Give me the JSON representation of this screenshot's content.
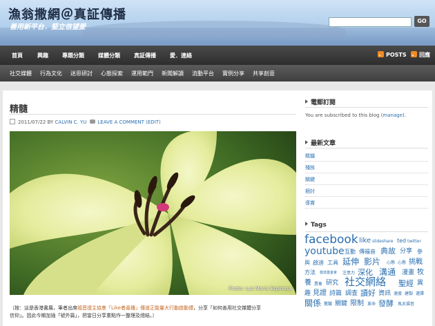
{
  "site": {
    "title": "漁翁撒網＠真証傳播",
    "tagline": "善用新平台．堅立信望愛",
    "search_button": "GO"
  },
  "nav_primary": {
    "items": [
      "首頁",
      "興趣",
      "專題分類",
      "媒體分類",
      "真証傳播",
      "愛．連絡"
    ],
    "feeds": [
      "POSTS",
      "回應"
    ]
  },
  "nav_secondary": {
    "items": [
      "社交媒體",
      "行為文化",
      "迷思研討",
      "心態探索",
      "運用範門",
      "新聞解讀",
      "流動平台",
      "實例分享",
      "共享創意"
    ]
  },
  "post": {
    "title": "精髓",
    "date": "2011/07/22",
    "by": "BY",
    "author": "CALVIN C. YU",
    "comment": "LEAVE A COMMENT",
    "edit": "(EDIT)",
    "photo_credit": "Photo: Luz Maria Espinosa",
    "caption_line1_a": "（按：這是香港書展，筆者出席",
    "caption_line1_link": "福音證主協會「Like者尋播」傳道正能量大行動啟動禮",
    "caption_line1_b": "，分享「如何善用社交媒體分享",
    "caption_line2": "信仰」。因此今期加插「號外篇」，把當日分享重點作一整理及總結。）"
  },
  "sidebar": {
    "email_title": "電郵訂閱",
    "subscribed_text_a": "You are subscribed to this blog (",
    "subscribed_link": "manage",
    "subscribed_text_b": ").",
    "recent_title": "最新文章",
    "recent_items": [
      "精髓",
      "殘核",
      "關鍵",
      "捆討",
      "導賞"
    ],
    "tags_title": "Tags",
    "tags": [
      "facebook",
      "like",
      "slideshare",
      "ted",
      "twitter",
      "youtube",
      "互動",
      "傳福音",
      "典故",
      "分享",
      "參",
      "與",
      "啟迪",
      "工具",
      "延伸",
      "影片",
      "心態",
      "心態",
      "挑戰",
      "方法",
      "施達基金會",
      "注意力",
      "深化",
      "溝通",
      "漫畫",
      "牧",
      "養",
      "異象",
      "研究",
      "社交網絡",
      "聖經",
      "異",
      "趣",
      "見證",
      "詩篇",
      "調查",
      "讀好",
      "資訊",
      "速度",
      "建製",
      "選擇",
      "關係",
      "驚聽",
      "關鍵",
      "限制",
      "革命",
      "發酵",
      "馬太福音"
    ]
  },
  "colors": {
    "link": "#2a6fb0",
    "nav_bg": "#3a3a3a",
    "rss": "#f08a24"
  }
}
